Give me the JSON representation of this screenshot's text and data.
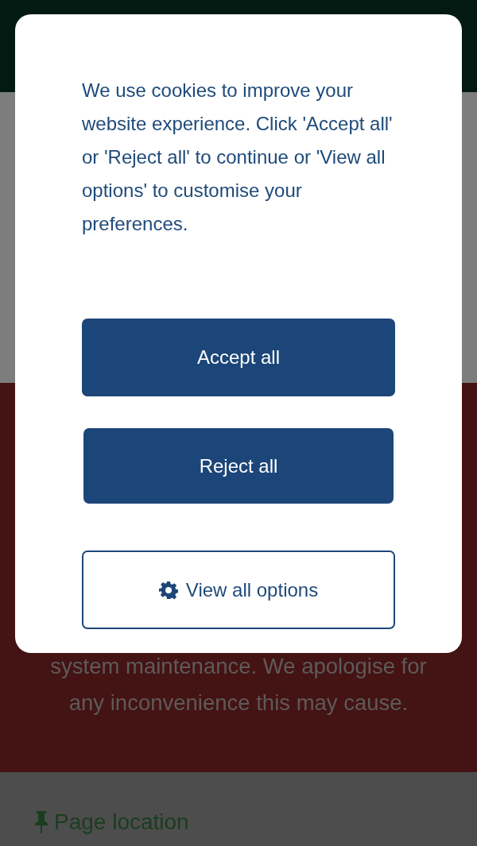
{
  "notice": {
    "text": "system maintenance. We apologise for any inconvenience this may cause."
  },
  "footer": {
    "label": "Page location"
  },
  "cookie_dialog": {
    "message": "We use cookies to improve your website experience. Click 'Accept all' or 'Reject all' to continue or 'View all options' to customise your preferences.",
    "buttons": [
      {
        "label": "Accept all",
        "kind": "primary"
      },
      {
        "label": "Reject all",
        "kind": "primary"
      },
      {
        "label": "View all options",
        "kind": "outline"
      }
    ]
  }
}
